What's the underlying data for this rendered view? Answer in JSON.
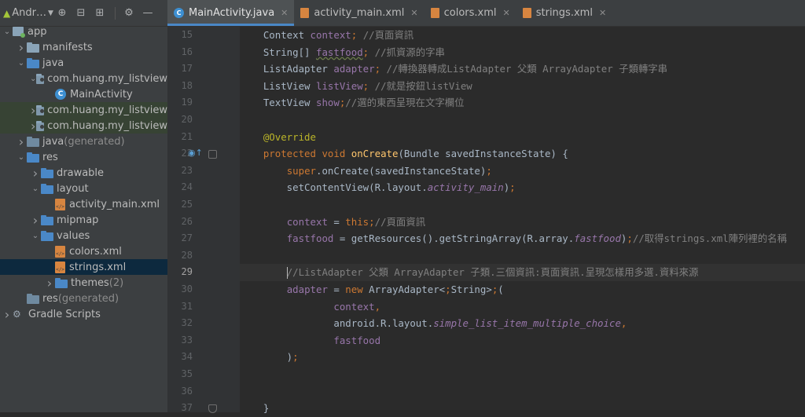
{
  "project": {
    "title": "Andr…",
    "tree": [
      {
        "label": "app",
        "level": 0,
        "expanded": true,
        "icon": "app-module-icon"
      },
      {
        "label": "manifests",
        "level": 1,
        "expanded": false,
        "icon": "folder-icon"
      },
      {
        "label": "java",
        "level": 1,
        "expanded": true,
        "icon": "folder-icon"
      },
      {
        "label": "com.huang.my_listview",
        "level": 2,
        "expanded": true,
        "icon": "package-icon"
      },
      {
        "label": "MainActivity",
        "level": 3,
        "icon": "class-icon"
      },
      {
        "label": "com.huang.my_listview",
        "level": 2,
        "expanded": false,
        "icon": "package-icon",
        "highlight": true
      },
      {
        "label": "com.huang.my_listview",
        "level": 2,
        "expanded": false,
        "icon": "package-icon",
        "highlight": true
      },
      {
        "label": "java",
        "suffix": " (generated)",
        "level": 1,
        "expanded": false,
        "icon": "folder-generated-icon"
      },
      {
        "label": "res",
        "level": 1,
        "expanded": true,
        "icon": "folder-icon"
      },
      {
        "label": "drawable",
        "level": 2,
        "expanded": false,
        "icon": "folder-icon"
      },
      {
        "label": "layout",
        "level": 2,
        "expanded": true,
        "icon": "folder-icon"
      },
      {
        "label": "activity_main.xml",
        "level": 3,
        "icon": "xml-icon"
      },
      {
        "label": "mipmap",
        "level": 2,
        "expanded": false,
        "icon": "folder-icon"
      },
      {
        "label": "values",
        "level": 2,
        "expanded": true,
        "icon": "folder-icon"
      },
      {
        "label": "colors.xml",
        "level": 3,
        "icon": "xml-icon"
      },
      {
        "label": "strings.xml",
        "level": 3,
        "icon": "xml-icon",
        "selected": true
      },
      {
        "label": "themes",
        "suffix": " (2)",
        "level": 3,
        "expanded": false,
        "icon": "folder-icon"
      },
      {
        "label": "res",
        "suffix": " (generated)",
        "level": 1,
        "icon": "folder-generated-icon"
      },
      {
        "label": "Gradle Scripts",
        "level": 0,
        "expanded": false,
        "icon": "gradle-icon"
      }
    ]
  },
  "tabs": [
    {
      "label": "MainActivity.java",
      "type": "class",
      "active": true
    },
    {
      "label": "activity_main.xml",
      "type": "xml"
    },
    {
      "label": "colors.xml",
      "type": "xml"
    },
    {
      "label": "strings.xml",
      "type": "xml"
    }
  ],
  "editor": {
    "current_line": 29,
    "lines": [
      {
        "n": 15,
        "text": "    Context context; //頁面資訊"
      },
      {
        "n": 16,
        "text": "    String[] fastfood; //抓資源的字串"
      },
      {
        "n": 17,
        "text": "    ListAdapter adapter; //轉換器轉成ListAdapter 父類 ArrayAdapter 子類轉字串"
      },
      {
        "n": 18,
        "text": "    ListView listView; //就是按鈕listView"
      },
      {
        "n": 19,
        "text": "    TextView show;//選的東西呈現在文字欄位"
      },
      {
        "n": 20,
        "text": ""
      },
      {
        "n": 21,
        "text": "    @Override"
      },
      {
        "n": 22,
        "text": "    protected void onCreate(Bundle savedInstanceState) {"
      },
      {
        "n": 23,
        "text": "        super.onCreate(savedInstanceState);"
      },
      {
        "n": 24,
        "text": "        setContentView(R.layout.activity_main);"
      },
      {
        "n": 25,
        "text": ""
      },
      {
        "n": 26,
        "text": "        context = this;//頁面資訊"
      },
      {
        "n": 27,
        "text": "        fastfood = getResources().getStringArray(R.array.fastfood);//取得strings.xml陣列裡的名稱"
      },
      {
        "n": 28,
        "text": ""
      },
      {
        "n": 29,
        "text": "        //ListAdapter 父類 ArrayAdapter 子類.三個資訊:頁面資訊.呈現怎樣用多選.資料來源"
      },
      {
        "n": 30,
        "text": "        adapter = new ArrayAdapter<String>("
      },
      {
        "n": 31,
        "text": "                context,"
      },
      {
        "n": 32,
        "text": "                android.R.layout.simple_list_item_multiple_choice,"
      },
      {
        "n": 33,
        "text": "                fastfood"
      },
      {
        "n": 34,
        "text": "        );"
      },
      {
        "n": 35,
        "text": ""
      },
      {
        "n": 36,
        "text": ""
      },
      {
        "n": 37,
        "text": "    }"
      }
    ]
  },
  "colors": {
    "keyword": "#cc7832",
    "field": "#9876aa",
    "method": "#ffc66d",
    "comment": "#808080",
    "annotation": "#bbb529",
    "text": "#a9b7c6",
    "accent": "#4a88c7"
  }
}
